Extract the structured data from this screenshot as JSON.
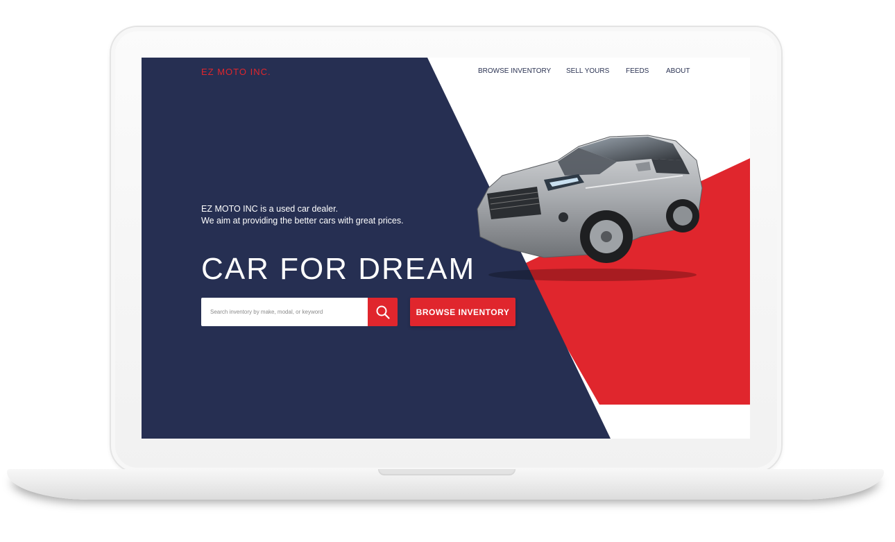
{
  "site": {
    "logo": "EZ MOTO INC."
  },
  "nav": {
    "items": [
      {
        "label": "BROWSE INVENTORY"
      },
      {
        "label": "SELL YOURS"
      },
      {
        "label": "FEEDS"
      },
      {
        "label": "ABOUT"
      }
    ]
  },
  "hero": {
    "tagline_line1": "EZ MOTO INC is a used car dealer.",
    "tagline_line2": "We aim at providing the better cars with great prices.",
    "title": "CAR FOR DREAM",
    "search": {
      "placeholder": "Search inventory by make, modal, or keyword",
      "icon": "search-icon"
    },
    "browse_button_label": "BROWSE INVENTORY"
  },
  "colors": {
    "navy": "#262f52",
    "red": "#e0262d",
    "white": "#ffffff"
  }
}
